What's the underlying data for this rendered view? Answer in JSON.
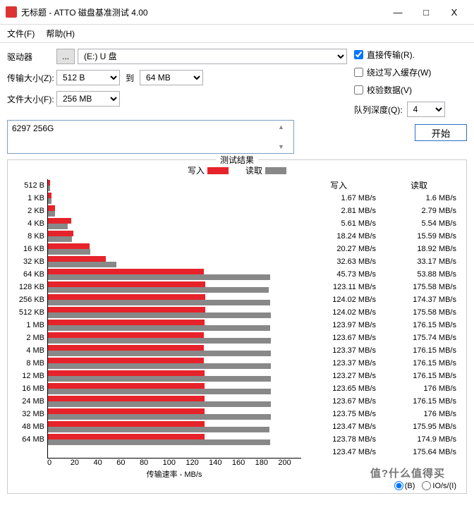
{
  "window": {
    "title": "无标题 - ATTO 磁盘基准测试 4.00",
    "min": "—",
    "max": "□",
    "close": "X"
  },
  "menu": {
    "file": "文件(F)",
    "help": "帮助(H)"
  },
  "form": {
    "drive_label": "驱动器",
    "browse": "...",
    "drive_value": "(E:) U 盘",
    "transfer_label": "传输大小(Z):",
    "transfer_from": "512 B",
    "to": "到",
    "transfer_to": "64 MB",
    "filesize_label": "文件大小(F):",
    "filesize_value": "256 MB",
    "direct": "直接传输(R).",
    "bypass": "绕过写入缓存(W)",
    "verify": "校验数据(V)",
    "qdepth_label": "队列深度(Q):",
    "qdepth_value": "4",
    "desc": "6297  256G",
    "start": "开始"
  },
  "chart_title": "测试结果",
  "legend": {
    "write": "写入",
    "read": "读取"
  },
  "xaxis_label": "传输速率 - MB/s",
  "footer": {
    "b": "(B)",
    "io": "IO/s/(I)"
  },
  "watermark": "值?什么值得买",
  "chart_data": {
    "type": "bar",
    "xlabel": "传输速率 MB/s",
    "xlim": [
      0,
      200
    ],
    "xticks": [
      0,
      20,
      40,
      60,
      80,
      100,
      120,
      140,
      160,
      180,
      200
    ],
    "categories": [
      "512 B",
      "1 KB",
      "2 KB",
      "4 KB",
      "8 KB",
      "16 KB",
      "32 KB",
      "64 KB",
      "128 KB",
      "256 KB",
      "512 KB",
      "1 MB",
      "2 MB",
      "4 MB",
      "8 MB",
      "12 MB",
      "16 MB",
      "24 MB",
      "32 MB",
      "48 MB",
      "64 MB"
    ],
    "series": [
      {
        "name": "写入",
        "unit": "MB/s",
        "values": [
          1.67,
          2.81,
          5.61,
          18.24,
          20.27,
          32.63,
          45.73,
          123.11,
          124.02,
          124.02,
          123.97,
          123.67,
          123.37,
          123.37,
          123.27,
          123.65,
          123.67,
          123.75,
          123.47,
          123.78,
          123.47
        ]
      },
      {
        "name": "读取",
        "unit": "MB/s",
        "values": [
          1.6,
          2.79,
          5.54,
          15.59,
          18.92,
          33.17,
          53.88,
          175.58,
          174.37,
          175.58,
          176.15,
          175.74,
          176.15,
          176.15,
          176.15,
          176,
          176.15,
          176,
          175.95,
          174.9,
          175.64
        ]
      }
    ]
  }
}
